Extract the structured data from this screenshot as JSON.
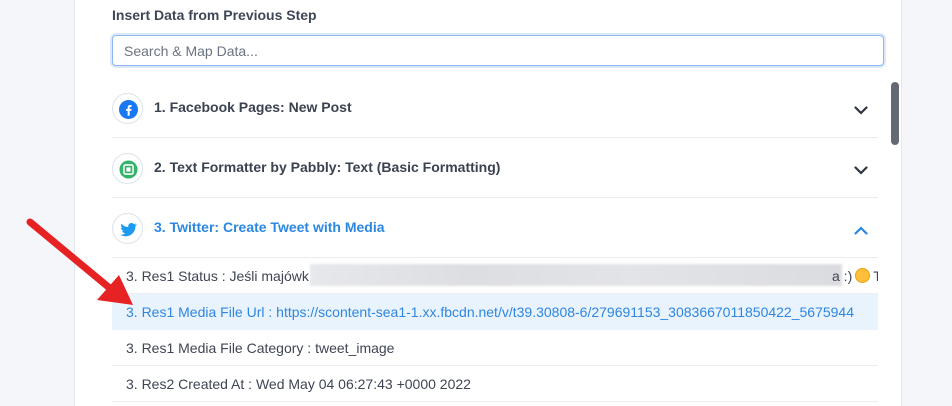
{
  "section_label": "Insert Data from Previous Step",
  "search": {
    "placeholder": "Search & Map Data..."
  },
  "steps": [
    {
      "title": "1. Facebook Pages: New Post",
      "icon": "facebook-icon",
      "color": "#1877f2",
      "expanded": false
    },
    {
      "title": "2. Text Formatter by Pabbly: Text (Basic Formatting)",
      "icon": "text-formatter-icon",
      "color": "#34b36b",
      "expanded": false
    },
    {
      "title": "3. Twitter: Create Tweet with Media",
      "icon": "twitter-icon",
      "color": "#1d9bf0",
      "expanded": true
    }
  ],
  "items": [
    {
      "label": "3. Res1 Status : Jeśli majówk",
      "tail_a": "a :)",
      "tail_b": "Ta",
      "blurred": true
    },
    {
      "label": "3. Res1 Media File Url : https://scontent-sea1-1.xx.fbcdn.net/v/t39.30808-6/279691153_3083667011850422_5675944",
      "selected": true
    },
    {
      "label": "3. Res1 Media File Category : tweet_image"
    },
    {
      "label": "3. Res2 Created At : Wed May 04 06:27:43 +0000 2022"
    }
  ],
  "colors": {
    "accent": "#2b87e0",
    "arrow": "#e62222",
    "selected_bg": "#e9f3fd"
  }
}
